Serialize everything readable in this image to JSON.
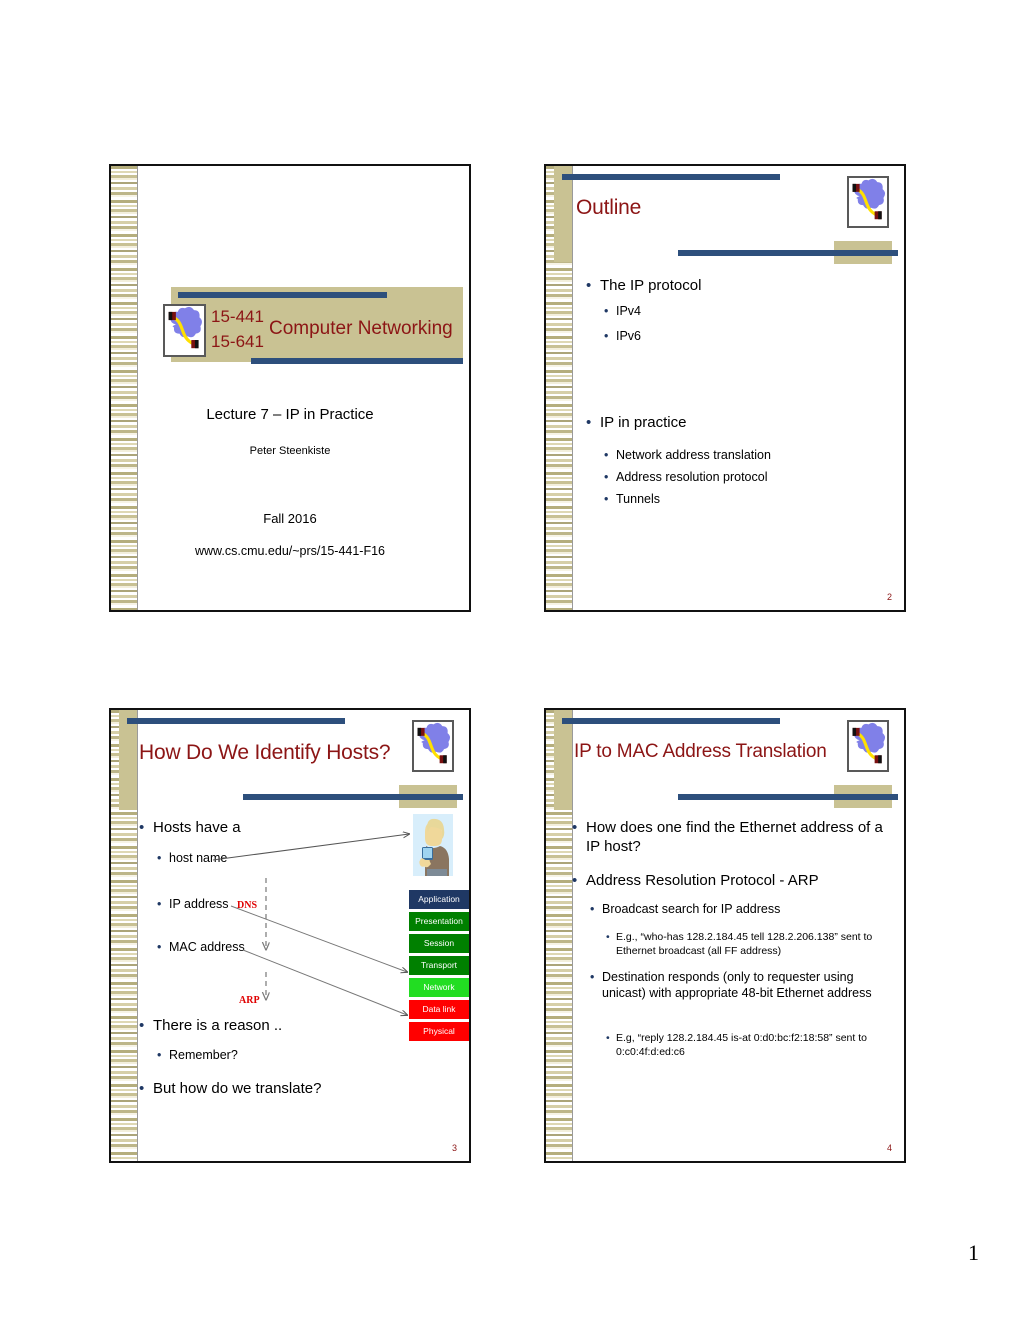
{
  "document": {
    "page_number": "1"
  },
  "slides": [
    {
      "id": "title-slide",
      "course_number_line1": "15-441",
      "course_number_line2": "15-641",
      "course_name": "Computer Networking",
      "lecture": "Lecture 7 – IP in Practice",
      "author": "Peter Steenkiste",
      "term": "Fall 2016",
      "url": "www.cs.cmu.edu/~prs/15-441-F16"
    },
    {
      "id": "outline-slide",
      "title": "Outline",
      "page_number": "2",
      "bullets": [
        {
          "level": 1,
          "text": "The IP protocol"
        },
        {
          "level": 2,
          "text": "IPv4"
        },
        {
          "level": 2,
          "text": "IPv6"
        },
        {
          "level": 1,
          "text": "IP in practice"
        },
        {
          "level": 2,
          "text": "Network address translation"
        },
        {
          "level": 2,
          "text": "Address resolution protocol"
        },
        {
          "level": 2,
          "text": "Tunnels"
        }
      ]
    },
    {
      "id": "identify-hosts-slide",
      "title": "How Do We Identify Hosts?",
      "page_number": "3",
      "bullets": [
        {
          "level": 1,
          "text": "Hosts have a"
        },
        {
          "level": 2,
          "text": "host name"
        },
        {
          "level": 2,
          "text": "IP address"
        },
        {
          "level": 2,
          "text": "MAC address"
        },
        {
          "level": 1,
          "text": "There is a reason .."
        },
        {
          "level": 2,
          "text": "Remember?"
        },
        {
          "level": 1,
          "text": "But how do we translate?"
        }
      ],
      "protocol_labels": [
        {
          "name": "dns-label",
          "text": "DNS"
        },
        {
          "name": "arp-label",
          "text": "ARP"
        }
      ],
      "osi_stack": [
        {
          "label": "Application",
          "color": "#1f3864"
        },
        {
          "label": "Presentation",
          "color": "#008000"
        },
        {
          "label": "Session",
          "color": "#008000"
        },
        {
          "label": "Transport",
          "color": "#008000"
        },
        {
          "label": "Network",
          "color": "#22dd22"
        },
        {
          "label": "Data link",
          "color": "#ff0000"
        },
        {
          "label": "Physical",
          "color": "#ff0000"
        }
      ]
    },
    {
      "id": "ip-to-mac-slide",
      "title": "IP to MAC Address Translation",
      "page_number": "4",
      "bullets": [
        {
          "level": 1,
          "text": "How does one find the Ethernet address of a IP host?"
        },
        {
          "level": 1,
          "text": "Address Resolution Protocol - ARP"
        },
        {
          "level": 2,
          "text": "Broadcast search for IP address"
        },
        {
          "level": 3,
          "text": "E.g., “who-has 128.2.184.45 tell 128.2.206.138” sent to Ethernet broadcast (all FF address)"
        },
        {
          "level": 2,
          "text": "Destination responds (only to requester using unicast) with appropriate 48-bit Ethernet address"
        },
        {
          "level": 3,
          "text": "E.g, “reply 128.2.184.45 is-at 0:d0:bc:f2:18:58” sent to 0:c0:4f:d:ed:c6"
        }
      ]
    }
  ],
  "theme": {
    "accent_navy": "#2d4f7c",
    "accent_khaki": "#c9c293",
    "title_red": "#8c1515",
    "bullet_navy": "#1f3864",
    "protocol_red": "#e00000"
  }
}
